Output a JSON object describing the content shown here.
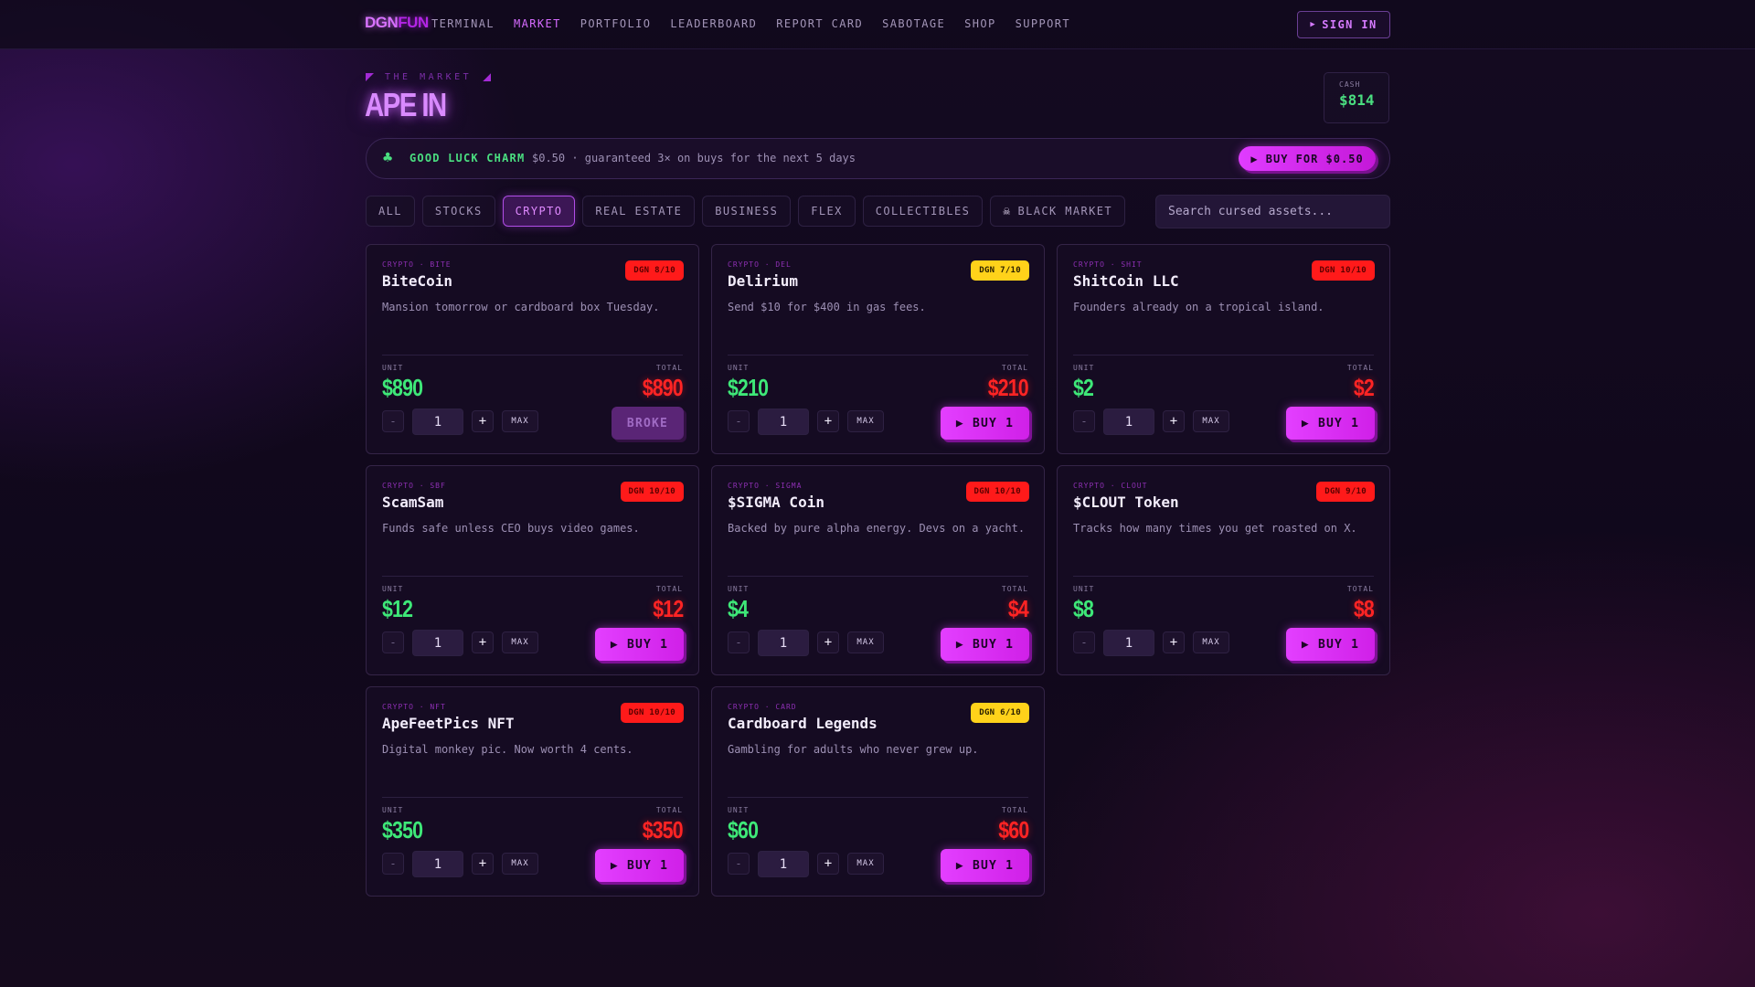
{
  "nav": {
    "logo_part1": "DGN",
    "logo_part2": "FUN",
    "items": [
      "TERMINAL",
      "MARKET",
      "PORTFOLIO",
      "LEADERBOARD",
      "REPORT CARD",
      "SABOTAGE",
      "SHOP",
      "SUPPORT"
    ],
    "active": "MARKET",
    "signin_label": "SIGN IN",
    "signin_icon": "play-triangle-icon"
  },
  "header": {
    "kicker": "THE MARKET",
    "title": "APE IN",
    "cash_label": "CASH",
    "cash_value": "$814"
  },
  "charm": {
    "icon": "clover-icon",
    "name": "GOOD LUCK CHARM",
    "description": "$0.50 · guaranteed 3× on buys for the next 5 days",
    "buy_label": "▶ BUY FOR $0.50"
  },
  "filters": {
    "items": [
      "ALL",
      "STOCKS",
      "CRYPTO",
      "REAL ESTATE",
      "BUSINESS",
      "FLEX",
      "COLLECTIBLES",
      "BLACK MARKET"
    ],
    "active": "CRYPTO",
    "black_market_icon": "skull-icon"
  },
  "search": {
    "placeholder": "Search cursed assets..."
  },
  "labels": {
    "unit": "UNIT",
    "total": "TOTAL",
    "max": "MAX",
    "minus": "-",
    "plus": "+"
  },
  "colors": {
    "accent": "#d66bff",
    "positive": "#3ee878",
    "negative": "#ff2424",
    "danger_badge": "#ff1a1a",
    "warn_badge": "#ffd21a"
  },
  "cards": [
    {
      "category": "CRYPTO · BITE",
      "name": "BiteCoin",
      "badge": "DGN 8/10",
      "badge_color": "red",
      "description": "Mansion tomorrow or cardboard box Tuesday.",
      "unit": "$890",
      "total": "$890",
      "qty": "1",
      "button": "BROKE",
      "broke": true
    },
    {
      "category": "CRYPTO · DEL",
      "name": "Delirium",
      "badge": "DGN 7/10",
      "badge_color": "yellow",
      "description": "Send $10 for $400 in gas fees.",
      "unit": "$210",
      "total": "$210",
      "qty": "1",
      "button": "▶ BUY 1",
      "broke": false
    },
    {
      "category": "CRYPTO · SHIT",
      "name": "ShitCoin LLC",
      "badge": "DGN 10/10",
      "badge_color": "red",
      "description": "Founders already on a tropical island.",
      "unit": "$2",
      "total": "$2",
      "qty": "1",
      "button": "▶ BUY 1",
      "broke": false
    },
    {
      "category": "CRYPTO · SBF",
      "name": "ScamSam",
      "badge": "DGN 10/10",
      "badge_color": "red",
      "description": "Funds safe unless CEO buys video games.",
      "unit": "$12",
      "total": "$12",
      "qty": "1",
      "button": "▶ BUY 1",
      "broke": false
    },
    {
      "category": "CRYPTO · SIGMA",
      "name": "$SIGMA Coin",
      "badge": "DGN 10/10",
      "badge_color": "red",
      "description": "Backed by pure alpha energy. Devs on a yacht.",
      "unit": "$4",
      "total": "$4",
      "qty": "1",
      "button": "▶ BUY 1",
      "broke": false
    },
    {
      "category": "CRYPTO · CLOUT",
      "name": "$CLOUT Token",
      "badge": "DGN 9/10",
      "badge_color": "red",
      "description": "Tracks how many times you get roasted on X.",
      "unit": "$8",
      "total": "$8",
      "qty": "1",
      "button": "▶ BUY 1",
      "broke": false
    },
    {
      "category": "CRYPTO · NFT",
      "name": "ApeFeetPics NFT",
      "badge": "DGN 10/10",
      "badge_color": "red",
      "description": "Digital monkey pic. Now worth 4 cents.",
      "unit": "$350",
      "total": "$350",
      "qty": "1",
      "button": "▶ BUY 1",
      "broke": false
    },
    {
      "category": "CRYPTO · CARD",
      "name": "Cardboard Legends",
      "badge": "DGN 6/10",
      "badge_color": "yellow",
      "description": "Gambling for adults who never grew up.",
      "unit": "$60",
      "total": "$60",
      "qty": "1",
      "button": "▶ BUY 1",
      "broke": false
    }
  ]
}
